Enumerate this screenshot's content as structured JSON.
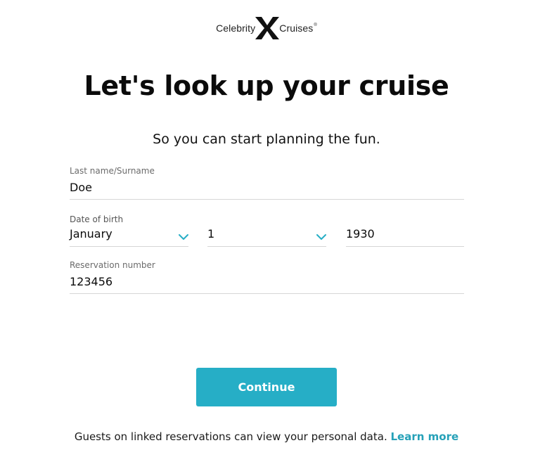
{
  "brand": {
    "name_left": "Celebrity",
    "name_right": "Cruises",
    "registered": "®",
    "accent_color": "#26aec6"
  },
  "heading": {
    "title": "Let's look up your cruise",
    "subtitle": "So you can start planning the fun."
  },
  "form": {
    "last_name": {
      "label": "Last name/Surname",
      "value": "Doe"
    },
    "date_of_birth": {
      "label": "Date of birth",
      "month": "January",
      "day": "1",
      "year": "1930",
      "chevron_icon": "chevron-down-icon"
    },
    "reservation": {
      "label": "Reservation number",
      "value": "123456"
    }
  },
  "actions": {
    "continue_label": "Continue"
  },
  "footer": {
    "note": "Guests on linked reservations can view your personal data.",
    "link_label": "Learn more"
  }
}
